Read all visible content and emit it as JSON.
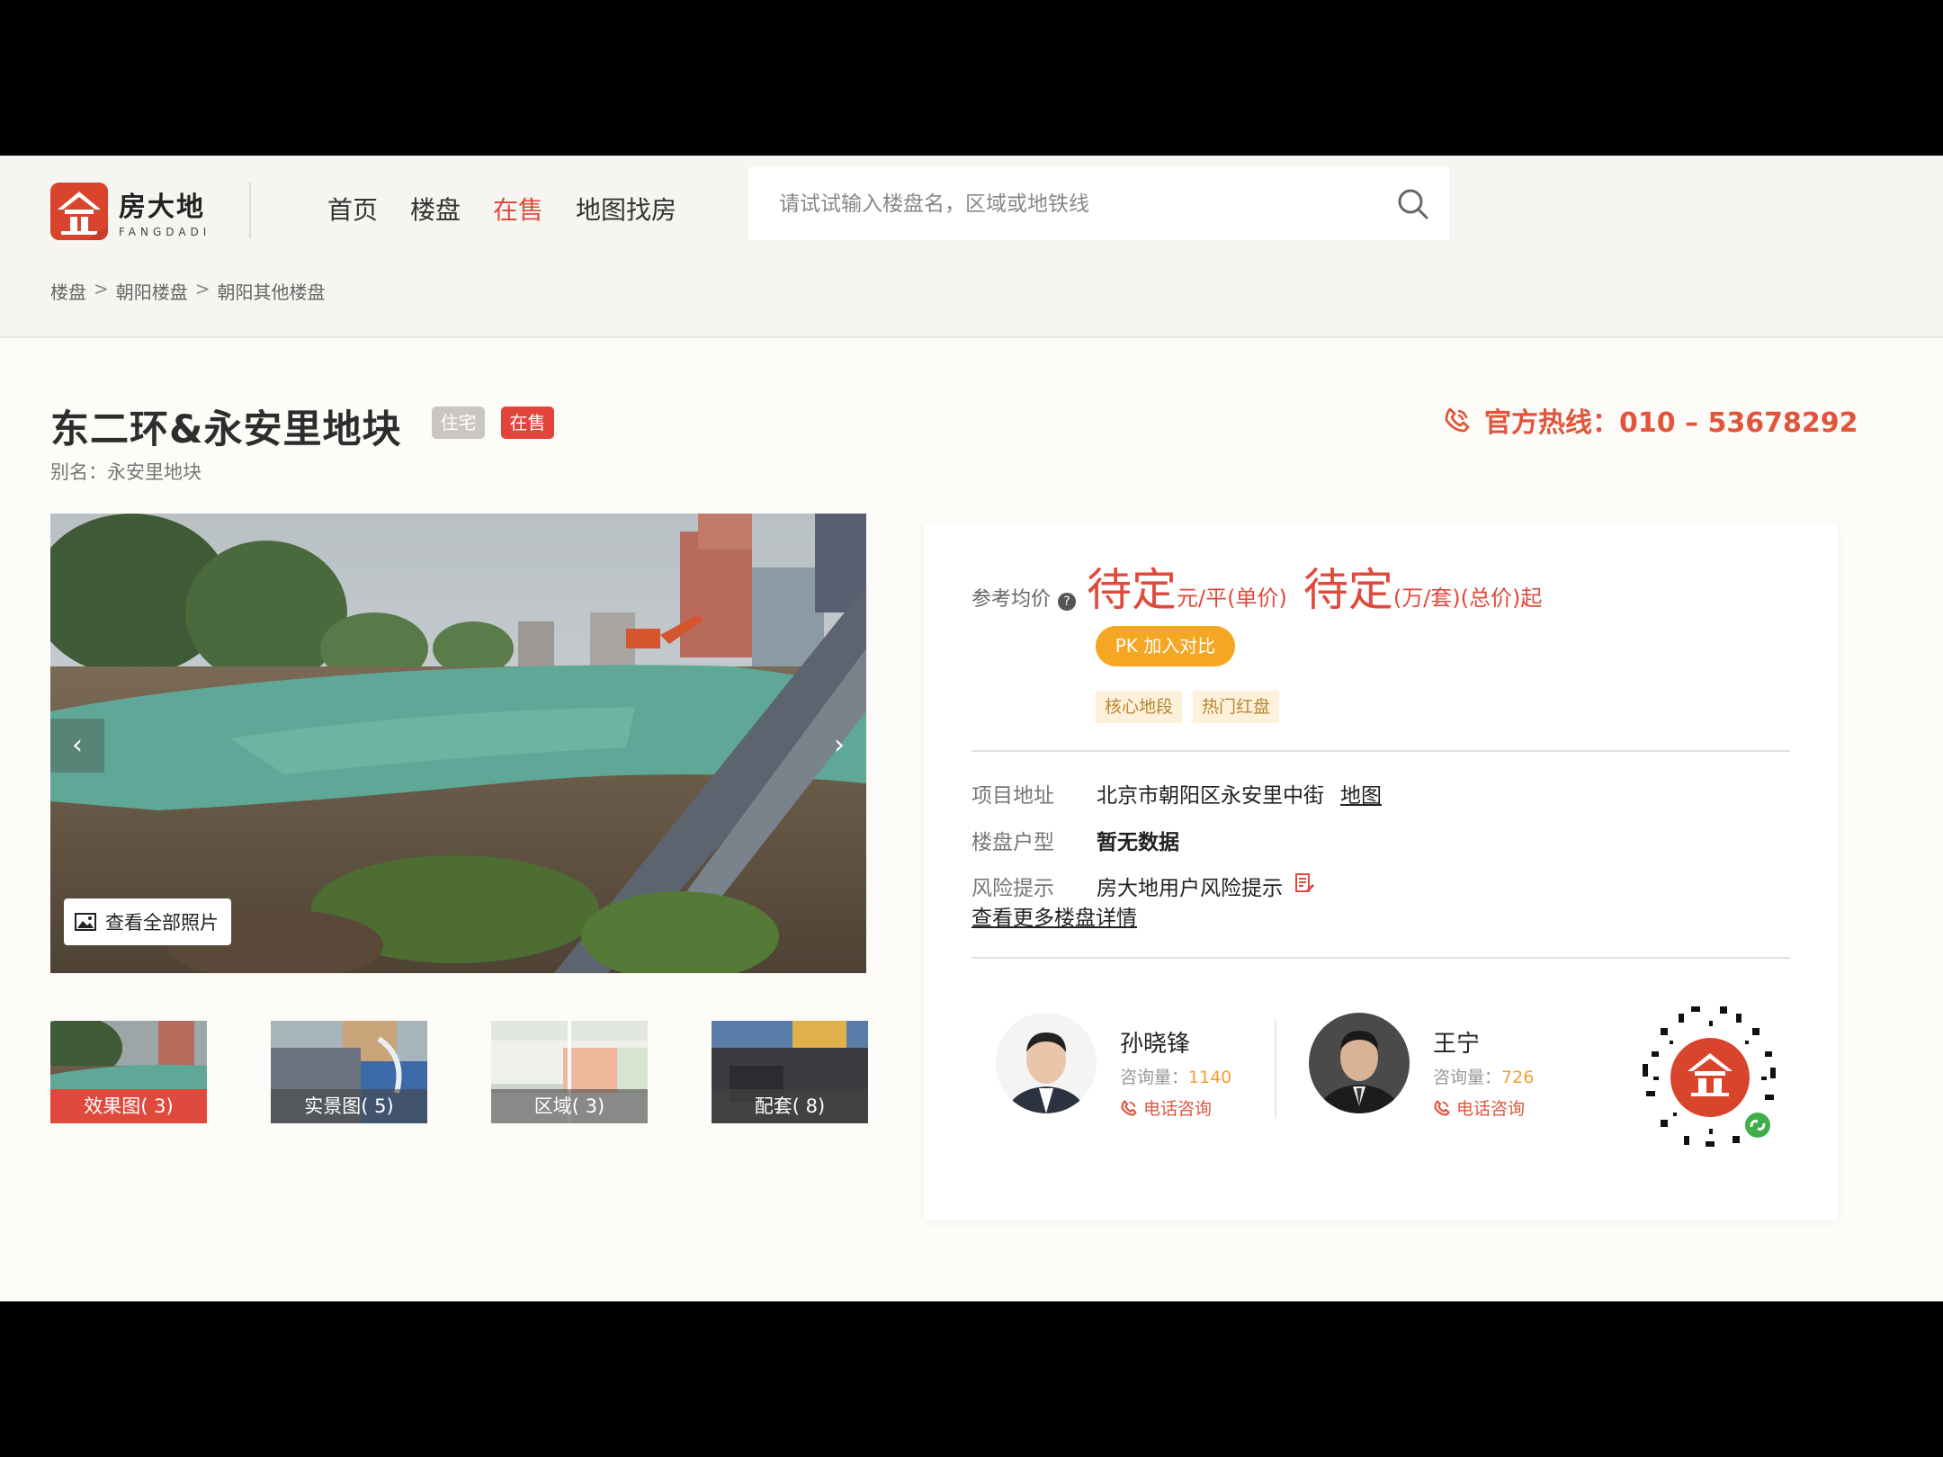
{
  "logo": {
    "name_cn": "房大地",
    "name_en": "FANGDADI"
  },
  "nav": {
    "items": [
      {
        "label": "首页"
      },
      {
        "label": "楼盘"
      },
      {
        "label": "在售"
      },
      {
        "label": "地图找房"
      }
    ]
  },
  "search": {
    "placeholder": "请试试输入楼盘名，区域或地铁线"
  },
  "breadcrumb": {
    "items": [
      "楼盘",
      "朝阳楼盘",
      "朝阳其他楼盘"
    ],
    "separator": ">"
  },
  "project": {
    "title": "东二环&永安里地块",
    "tag_type": "住宅",
    "tag_status": "在售",
    "alias": "别名：永安里地块"
  },
  "hotline": {
    "text": "官方热线：010 – 53678292"
  },
  "gallery": {
    "view_all_label": "查看全部照片",
    "thumbs": [
      {
        "label": "效果图( 3)"
      },
      {
        "label": "实景图( 5)"
      },
      {
        "label": "区域( 3)"
      },
      {
        "label": "配套( 8)"
      }
    ]
  },
  "price": {
    "label": "参考均价",
    "help": "?",
    "unit_price": "待定",
    "unit_price_unit": "元/平(单价)",
    "total_price": "待定",
    "total_price_unit": "(万/套)(总价)起",
    "pk_label": "PK 加入对比"
  },
  "features": [
    "核心地段",
    "热门红盘"
  ],
  "info": {
    "address_key": "项目地址",
    "address_val": "北京市朝阳区永安里中街",
    "map_link": "地图",
    "layout_key": "楼盘户型",
    "layout_val": "暂无数据",
    "risk_key": "风险提示",
    "risk_val": "房大地用户风险提示",
    "more_link": "查看更多楼盘详情"
  },
  "agents": [
    {
      "name": "孙晓锋",
      "count_label": "咨询量：",
      "count": "1140",
      "call_label": "电话咨询"
    },
    {
      "name": "王宁",
      "count_label": "咨询量：",
      "count": "726",
      "call_label": "电话咨询"
    }
  ],
  "colors": {
    "brand": "#e04a3c",
    "accent": "#f5a623",
    "hotline": "#e0553c"
  }
}
